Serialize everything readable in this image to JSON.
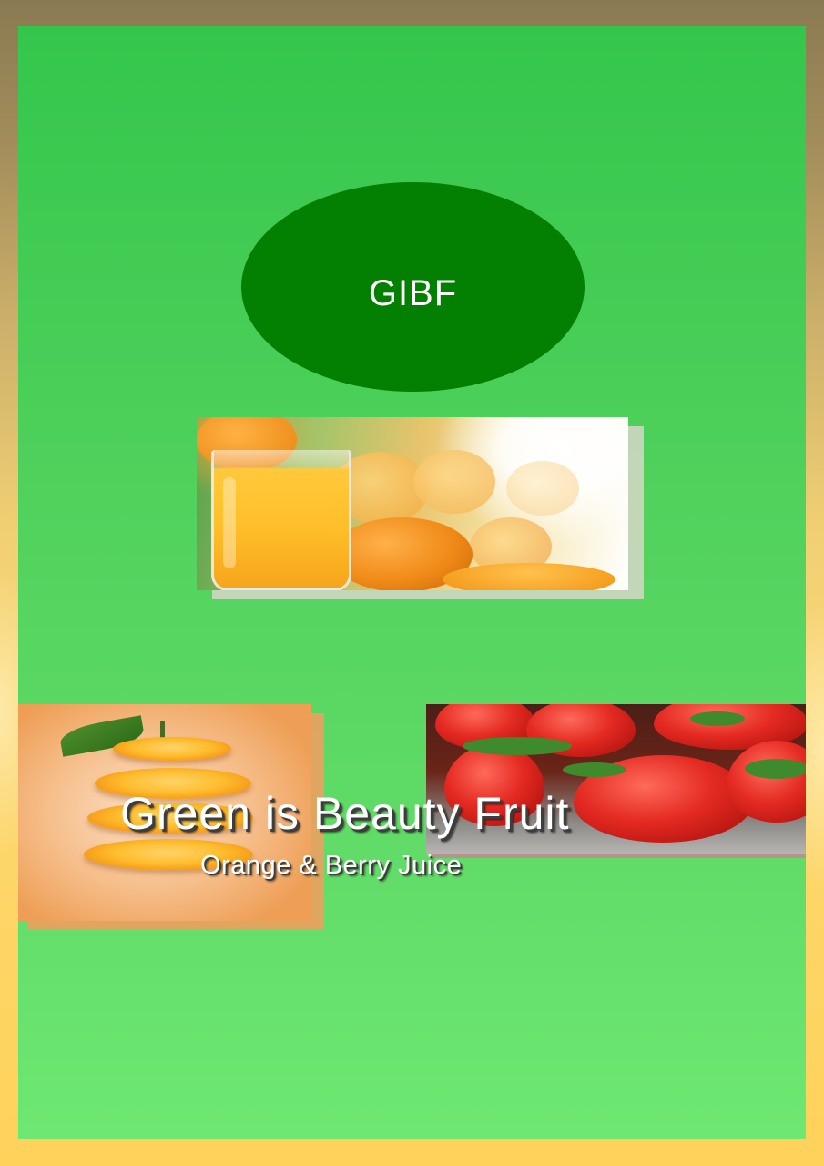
{
  "brand": {
    "logo_text": "GIBF"
  },
  "headline": {
    "title": "Green is Beauty Fruit",
    "subtitle": "Orange & Berry Juice"
  },
  "images": [
    {
      "name": "orange-juice-glass-photo"
    },
    {
      "name": "sliced-orange-photo"
    },
    {
      "name": "strawberries-photo"
    }
  ],
  "colors": {
    "panel_green": "#4fd15c",
    "logo_green": "#038002",
    "frame_gold": "#fbd775"
  }
}
